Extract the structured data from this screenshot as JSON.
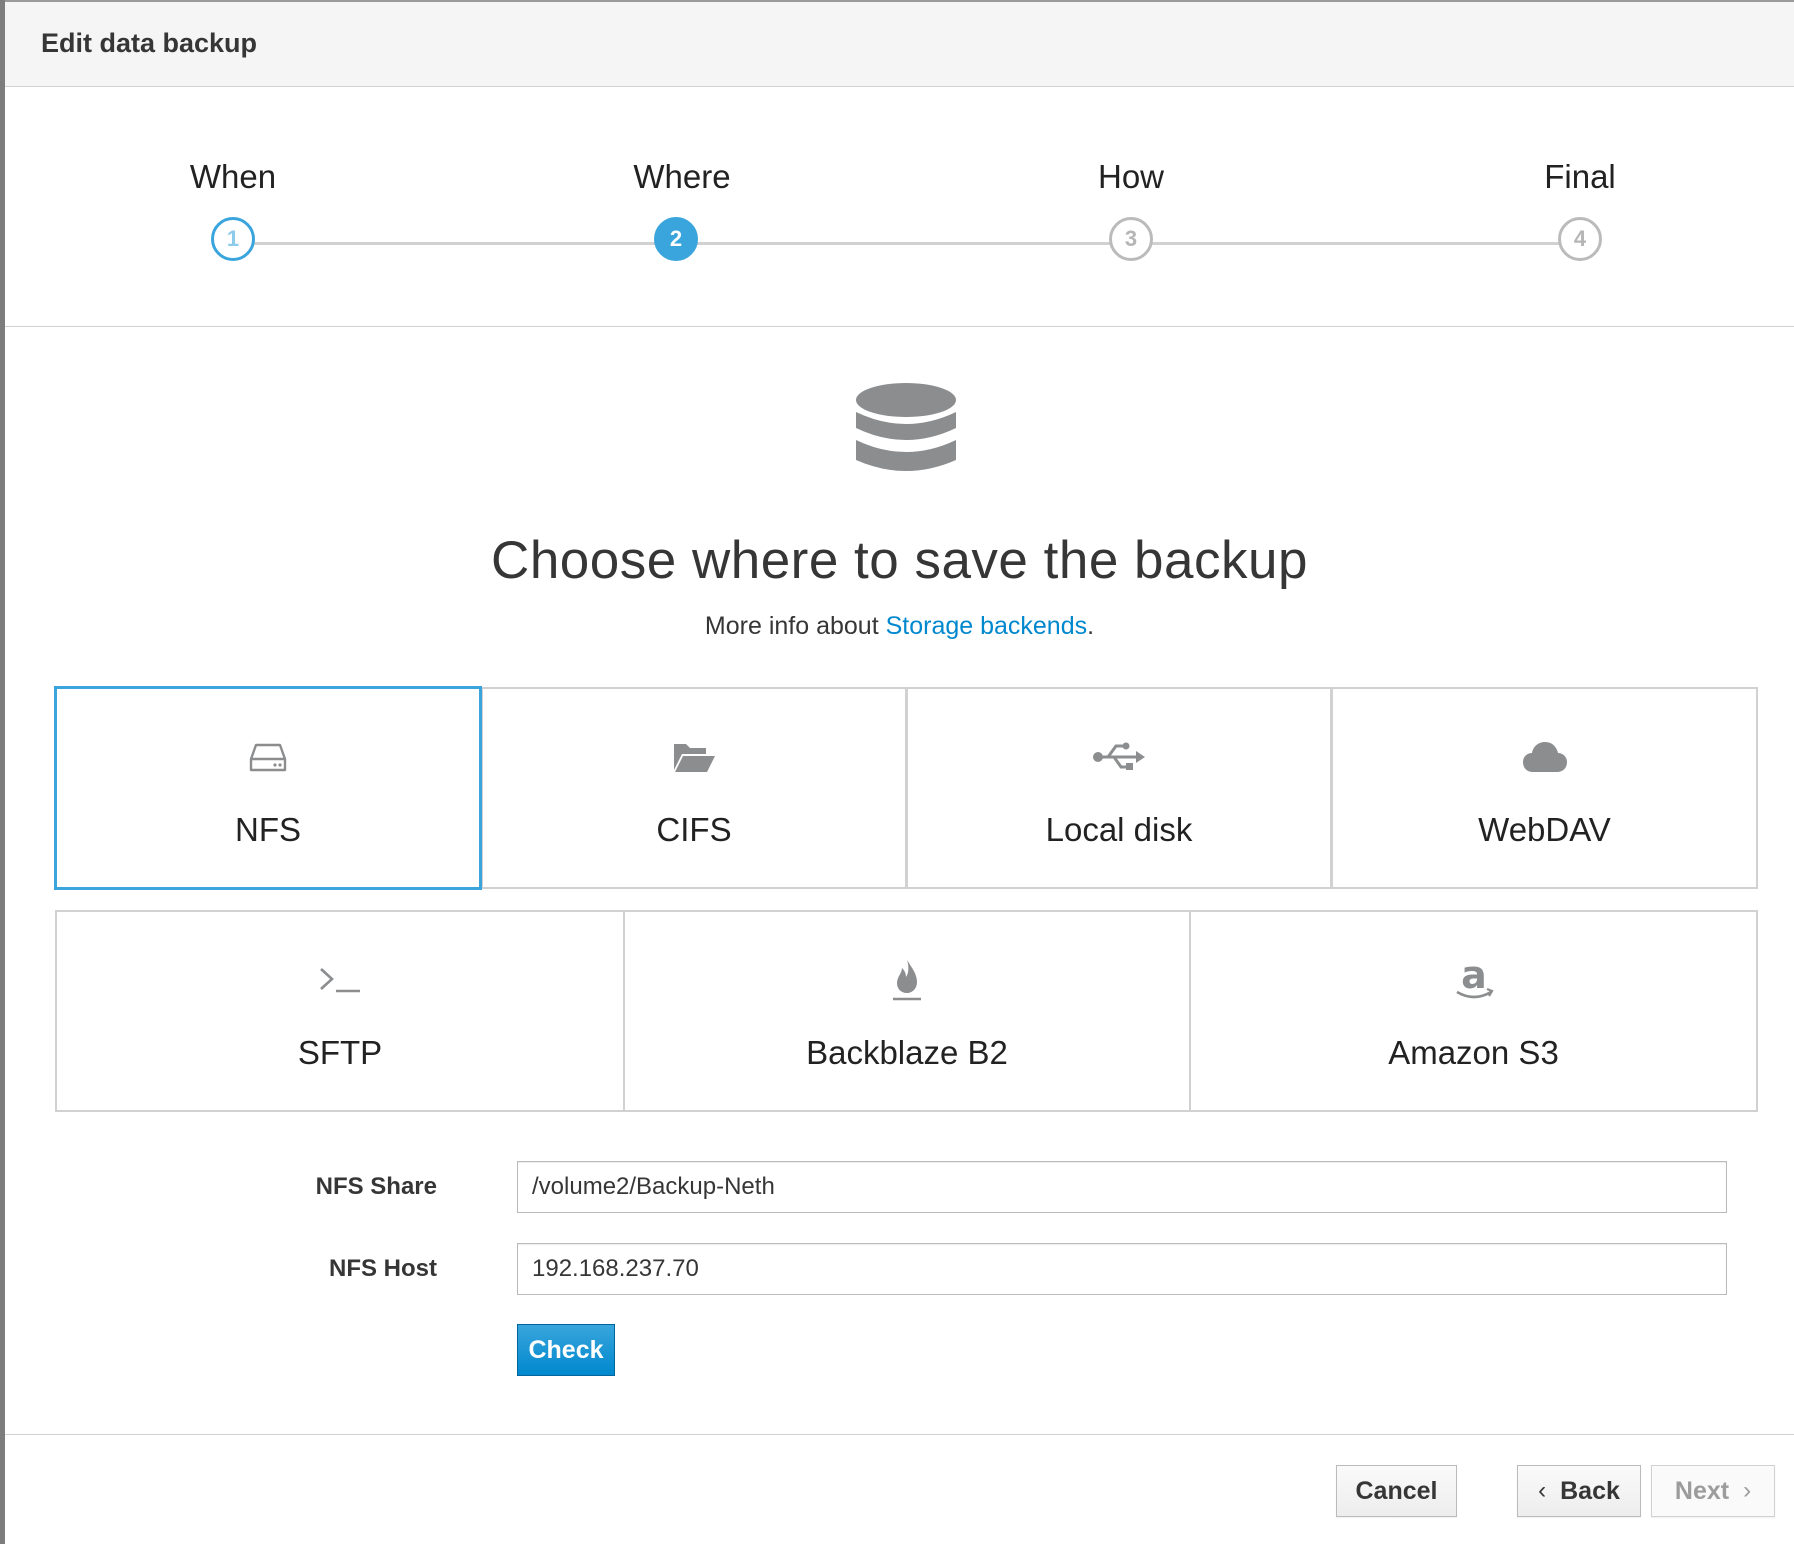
{
  "dialog": {
    "title": "Edit data backup"
  },
  "wizard": {
    "steps": [
      {
        "label": "When",
        "number": "1",
        "state": "done"
      },
      {
        "label": "Where",
        "number": "2",
        "state": "active"
      },
      {
        "label": "How",
        "number": "3",
        "state": "pending"
      },
      {
        "label": "Final",
        "number": "4",
        "state": "pending"
      }
    ]
  },
  "main": {
    "icon": "database-icon",
    "title": "Choose where to save the backup",
    "info_prefix": "More info about ",
    "info_link": "Storage backends",
    "info_suffix": "."
  },
  "backends": [
    {
      "label": "NFS",
      "icon": "hdd-icon",
      "selected": true
    },
    {
      "label": "CIFS",
      "icon": "folder-open-icon",
      "selected": false
    },
    {
      "label": "Local disk",
      "icon": "usb-icon",
      "selected": false
    },
    {
      "label": "WebDAV",
      "icon": "cloud-icon",
      "selected": false
    },
    {
      "label": "SFTP",
      "icon": "terminal-icon",
      "selected": false
    },
    {
      "label": "Backblaze B2",
      "icon": "flame-icon",
      "selected": false
    },
    {
      "label": "Amazon S3",
      "icon": "amazon-icon",
      "selected": false
    }
  ],
  "form": {
    "nfs_share_label": "NFS Share",
    "nfs_share_value": "/volume2/Backup-Neth",
    "nfs_host_label": "NFS Host",
    "nfs_host_value": "192.168.237.70",
    "check_label": "Check"
  },
  "footer": {
    "cancel_label": "Cancel",
    "back_label": "Back",
    "next_label": "Next"
  },
  "colors": {
    "accent": "#39a5dc",
    "button_primary": "#0088ce",
    "link": "#0088ce",
    "icon_gray": "#8b8d8f"
  }
}
